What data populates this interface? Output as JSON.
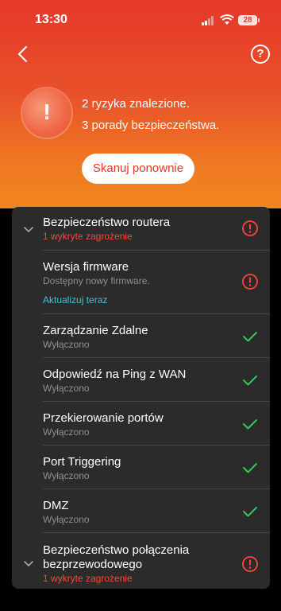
{
  "status_bar": {
    "time": "13:30",
    "battery": "28"
  },
  "header": {
    "help_label": "?"
  },
  "summary": {
    "badge": "!",
    "line1": "2 ryzyka znalezione.",
    "line2": "3 porady bezpieczeństwa.",
    "rescan_label": "Skanuj ponownie"
  },
  "colors": {
    "accent": "#e5382a",
    "warning": "#ff453a",
    "ok": "#34c759",
    "link": "#40c4d8",
    "panel": "#2b2b2b"
  },
  "sections": [
    {
      "title": "Bezpieczeństwo routera",
      "subtitle": "1 wykryte zagrożenie",
      "status": "warning-icon",
      "items": [
        {
          "title": "Wersja firmware",
          "subtitle": "Dostępny nowy firmware.",
          "link": "Aktualizuj teraz",
          "status": "warning-icon"
        },
        {
          "title": "Zarządzanie Zdalne",
          "subtitle": "Wyłączono",
          "status": "check-icon"
        },
        {
          "title": "Odpowiedź na Ping z WAN",
          "subtitle": "Wyłączono",
          "status": "check-icon"
        },
        {
          "title": "Przekierowanie portów",
          "subtitle": "Wyłączono",
          "status": "check-icon"
        },
        {
          "title": "Port Triggering",
          "subtitle": "Wyłączono",
          "status": "check-icon"
        },
        {
          "title": "DMZ",
          "subtitle": "Wyłączono",
          "status": "check-icon"
        }
      ]
    },
    {
      "title_line1": "Bezpieczeństwo połączenia",
      "title_line2": "bezprzewodowego",
      "subtitle": "1 wykryte zagrożenie",
      "status": "warning-icon"
    }
  ]
}
